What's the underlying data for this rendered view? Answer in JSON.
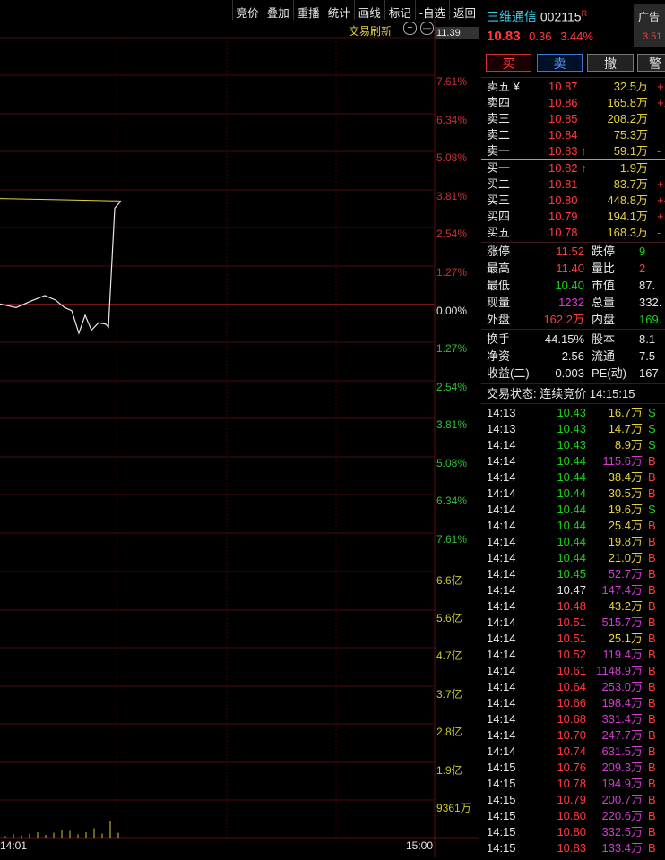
{
  "menu": [
    "竞价",
    "叠加",
    "重播",
    "统计",
    "画线",
    "标记",
    "-自选",
    "返回"
  ],
  "chart": {
    "refresh_label": "交易刷新",
    "top_price": "11.39",
    "price_scale_up": [
      "7.61%",
      "6.34%",
      "5.08%",
      "3.81%",
      "2.54%",
      "1.27%"
    ],
    "zero": "0.00%",
    "price_scale_down": [
      "1.27%",
      "2.54%",
      "3.81%",
      "5.08%",
      "6.34%",
      "7.61%"
    ],
    "vol_scale": [
      "6.6亿",
      "5.6亿",
      "4.7亿",
      "3.7亿",
      "2.8亿",
      "1.9亿",
      "9361万"
    ],
    "time_start": "14:01",
    "time_end": "15:00",
    "price_line": [
      0.02,
      -0.1,
      0.12,
      0.3,
      0.15,
      -0.1,
      -0.2,
      -0.95,
      -0.35,
      -0.85,
      -0.6,
      -0.65,
      -0.75,
      3.2,
      3.44
    ],
    "avg_line": [
      3.52,
      3.48,
      3.44
    ],
    "volume": [
      0.05,
      0.12,
      0.08,
      0.15,
      0.2,
      0.1,
      0.18,
      0.3,
      0.25,
      0.12,
      0.2,
      0.35,
      0.15,
      0.6,
      0.18
    ]
  },
  "stock": {
    "name": "三维通信",
    "code": "002115",
    "badge": "R",
    "price": "10.83",
    "change": "0.36",
    "pct": "3.44%",
    "ad_label": "广告",
    "ad_value": "3.51"
  },
  "buttons": {
    "buy": "买",
    "sell": "卖",
    "cancel": "撤",
    "alert": "警"
  },
  "asks": [
    {
      "label": "卖五 ¥",
      "price": "10.87",
      "vol": "32.5万",
      "diff": "+"
    },
    {
      "label": "卖四",
      "price": "10.86",
      "vol": "165.8万",
      "diff": "+1"
    },
    {
      "label": "卖三",
      "price": "10.85",
      "vol": "208.2万",
      "diff": ""
    },
    {
      "label": "卖二",
      "price": "10.84",
      "vol": "75.3万",
      "diff": ""
    },
    {
      "label": "卖一",
      "price": "10.83 ↑",
      "vol": "59.1万",
      "diff": "-"
    }
  ],
  "bids": [
    {
      "label": "买一",
      "price": "10.82 ↑",
      "vol": "1.9万",
      "diff": ""
    },
    {
      "label": "买二",
      "price": "10.81",
      "vol": "83.7万",
      "diff": "+"
    },
    {
      "label": "买三",
      "price": "10.80",
      "vol": "448.8万",
      "diff": "+4"
    },
    {
      "label": "买四",
      "price": "10.79",
      "vol": "194.1万",
      "diff": "+"
    },
    {
      "label": "买五",
      "price": "10.78",
      "vol": "168.3万",
      "diff": "-"
    }
  ],
  "stats": {
    "zhangting": "涨停",
    "zhangting_v": "11.52",
    "dieting": "跌停",
    "dieting_v": "9",
    "zuigao": "最高",
    "zuigao_v": "11.40",
    "liangbi": "量比",
    "liangbi_v": "2",
    "zuidi": "最低",
    "zuidi_v": "10.40",
    "shizhi": "市值",
    "shizhi_v": "87.",
    "xianliang": "现量",
    "xianliang_v": "1232",
    "zongliang": "总量",
    "zongliang_v": "332.",
    "waipan": "外盘",
    "waipan_v": "162.2万",
    "neipan": "内盘",
    "neipan_v": "169.",
    "huanshou": "换手",
    "huanshou_v": "44.15%",
    "guben": "股本",
    "guben_v": "8.1",
    "jingzi": "净资",
    "jingzi_v": "2.56",
    "liutong": "流通",
    "liutong_v": "7.5",
    "shouyi": "收益(二)",
    "shouyi_v": "0.003",
    "pe": "PE(动)",
    "pe_v": "167"
  },
  "trade_status": "交易状态: 连续竞价 14:15:15",
  "ticks": [
    {
      "t": "14:13",
      "p": "10.43",
      "v": "16.7万",
      "s": "S",
      "pc": "green",
      "vc": "yellow"
    },
    {
      "t": "14:13",
      "p": "10.43",
      "v": "14.7万",
      "s": "S",
      "pc": "green",
      "vc": "yellow"
    },
    {
      "t": "14:14",
      "p": "10.43",
      "v": "8.9万",
      "s": "S",
      "pc": "green",
      "vc": "yellow"
    },
    {
      "t": "14:14",
      "p": "10.44",
      "v": "115.6万",
      "s": "B",
      "pc": "green",
      "vc": "purple"
    },
    {
      "t": "14:14",
      "p": "10.44",
      "v": "38.4万",
      "s": "B",
      "pc": "green",
      "vc": "yellow"
    },
    {
      "t": "14:14",
      "p": "10.44",
      "v": "30.5万",
      "s": "B",
      "pc": "green",
      "vc": "yellow"
    },
    {
      "t": "14:14",
      "p": "10.44",
      "v": "19.6万",
      "s": "S",
      "pc": "green",
      "vc": "yellow"
    },
    {
      "t": "14:14",
      "p": "10.44",
      "v": "25.4万",
      "s": "B",
      "pc": "green",
      "vc": "yellow"
    },
    {
      "t": "14:14",
      "p": "10.44",
      "v": "19.8万",
      "s": "B",
      "pc": "green",
      "vc": "yellow"
    },
    {
      "t": "14:14",
      "p": "10.44",
      "v": "21.0万",
      "s": "B",
      "pc": "green",
      "vc": "yellow"
    },
    {
      "t": "14:14",
      "p": "10.45",
      "v": "52.7万",
      "s": "B",
      "pc": "green",
      "vc": "purple"
    },
    {
      "t": "14:14",
      "p": "10.47",
      "v": "147.4万",
      "s": "B",
      "pc": "white",
      "vc": "purple"
    },
    {
      "t": "14:14",
      "p": "10.48",
      "v": "43.2万",
      "s": "B",
      "pc": "red",
      "vc": "yellow"
    },
    {
      "t": "14:14",
      "p": "10.51",
      "v": "515.7万",
      "s": "B",
      "pc": "red",
      "vc": "purple"
    },
    {
      "t": "14:14",
      "p": "10.51",
      "v": "25.1万",
      "s": "B",
      "pc": "red",
      "vc": "yellow"
    },
    {
      "t": "14:14",
      "p": "10.52",
      "v": "119.4万",
      "s": "B",
      "pc": "red",
      "vc": "purple"
    },
    {
      "t": "14:14",
      "p": "10.61",
      "v": "1148.9万",
      "s": "B",
      "pc": "red",
      "vc": "purple"
    },
    {
      "t": "14:14",
      "p": "10.64",
      "v": "253.0万",
      "s": "B",
      "pc": "red",
      "vc": "purple"
    },
    {
      "t": "14:14",
      "p": "10.66",
      "v": "198.4万",
      "s": "B",
      "pc": "red",
      "vc": "purple"
    },
    {
      "t": "14:14",
      "p": "10.68",
      "v": "331.4万",
      "s": "B",
      "pc": "red",
      "vc": "purple"
    },
    {
      "t": "14:14",
      "p": "10.70",
      "v": "247.7万",
      "s": "B",
      "pc": "red",
      "vc": "purple"
    },
    {
      "t": "14:14",
      "p": "10.74",
      "v": "631.5万",
      "s": "B",
      "pc": "red",
      "vc": "purple"
    },
    {
      "t": "14:15",
      "p": "10.76",
      "v": "209.3万",
      "s": "B",
      "pc": "red",
      "vc": "purple"
    },
    {
      "t": "14:15",
      "p": "10.78",
      "v": "194.9万",
      "s": "B",
      "pc": "red",
      "vc": "purple"
    },
    {
      "t": "14:15",
      "p": "10.79",
      "v": "200.7万",
      "s": "B",
      "pc": "red",
      "vc": "purple"
    },
    {
      "t": "14:15",
      "p": "10.80",
      "v": "220.6万",
      "s": "B",
      "pc": "red",
      "vc": "purple"
    },
    {
      "t": "14:15",
      "p": "10.80",
      "v": "332.5万",
      "s": "B",
      "pc": "red",
      "vc": "purple"
    },
    {
      "t": "14:15",
      "p": "10.83",
      "v": "133.4万",
      "s": "B",
      "pc": "red",
      "vc": "purple"
    }
  ]
}
